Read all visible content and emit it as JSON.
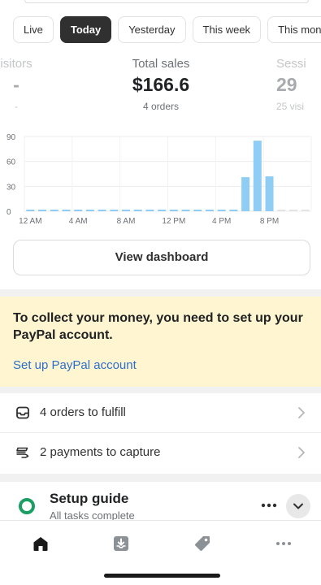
{
  "date_tabs": [
    {
      "label": "Live",
      "active": false
    },
    {
      "label": "Today",
      "active": true
    },
    {
      "label": "Yesterday",
      "active": false
    },
    {
      "label": "This week",
      "active": false
    },
    {
      "label": "This mont",
      "active": false
    }
  ],
  "metrics": {
    "left": {
      "label": "isitors",
      "value": "-",
      "sub": "-"
    },
    "center": {
      "label": "Total sales",
      "value": "$166.6",
      "sub": "4 orders"
    },
    "right": {
      "label": "Sessi",
      "value": "29",
      "sub": "25 visi"
    }
  },
  "chart_data": {
    "type": "bar",
    "categories": [
      "12 AM",
      "1 AM",
      "2 AM",
      "3 AM",
      "4 AM",
      "5 AM",
      "6 AM",
      "7 AM",
      "8 AM",
      "9 AM",
      "10 AM",
      "11 AM",
      "12 PM",
      "1 PM",
      "2 PM",
      "3 PM",
      "4 PM",
      "5 PM",
      "6 PM",
      "7 PM",
      "8 PM",
      "9 PM",
      "10 PM",
      "11 PM"
    ],
    "values": [
      0,
      0,
      0,
      0,
      0,
      0,
      0,
      0,
      0,
      0,
      0,
      0,
      0,
      0,
      0,
      0,
      0,
      0,
      41,
      85,
      42,
      0,
      0,
      0
    ],
    "x_tick_labels": [
      "12 AM",
      "4 AM",
      "8 AM",
      "12 PM",
      "4 PM",
      "8 PM"
    ],
    "y_ticks": [
      0,
      30,
      60,
      90
    ],
    "ylim": [
      0,
      90
    ],
    "grid": true,
    "bar_color": "#8fcdf5",
    "future_bar_color": "#e3e4e6"
  },
  "view_dashboard_label": "View dashboard",
  "paypal_banner": {
    "message": "To collect your money, you need to set up your PayPal account.",
    "link_label": "Set up PayPal account",
    "background": "#fff5d1",
    "link_color": "#2c6ecb"
  },
  "tasks": [
    {
      "icon": "inbox-icon",
      "label": "4 orders to fulfill"
    },
    {
      "icon": "payment-icon",
      "label": "2 payments to capture"
    }
  ],
  "setup_guide": {
    "title": "Setup guide",
    "subtitle": "All tasks complete",
    "ring_color": "#1a9e63"
  },
  "bottom_nav": [
    "home-icon",
    "orders-icon",
    "products-icon",
    "more-icon"
  ]
}
